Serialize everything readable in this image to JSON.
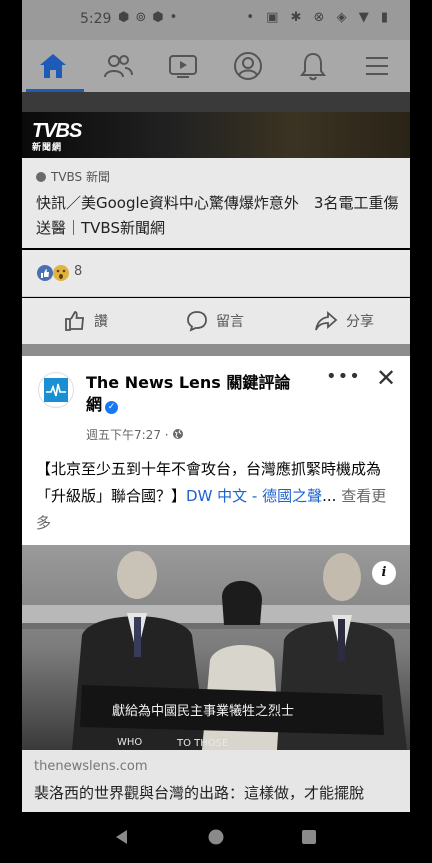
{
  "status_bar": {
    "time": "5:29"
  },
  "tvbs_post": {
    "logo_text": "TVBS",
    "logo_sub": "新聞網",
    "source_label": "TVBS 新聞",
    "headline": "快訊／美Google資料中心驚傳爆炸意外　3名電工重傷送醫｜TVBS新聞網",
    "reaction_count": "8",
    "like_label": "讚",
    "comment_label": "留言",
    "share_label": "分享"
  },
  "news_post": {
    "page_name": "The News Lens 關鍵評論網",
    "timestamp": "週五下午7:27 ·",
    "more_label": "•••",
    "close_label": "✕",
    "body_text": "【北京至少五到十年不會攻台，台灣應抓緊時機成為「升級版」聯合國？】",
    "body_link": "DW 中文 - 德國之聲",
    "ellipsis": "...",
    "see_more": "查看更多",
    "info_label": "i"
  },
  "link_preview": {
    "domain": "thenewslens.com",
    "title": "裴洛西的世界觀與台灣的出路：這樣做，才能擺脫"
  },
  "photo_text": {
    "banner": "獻給為中國民主事業犧牲之烈士",
    "caption1": "WHO",
    "caption2": "TO THOSE"
  },
  "colors": {
    "accent": "#1877f2",
    "link": "#1d63cc",
    "nav_active": "#1e5ab8"
  }
}
